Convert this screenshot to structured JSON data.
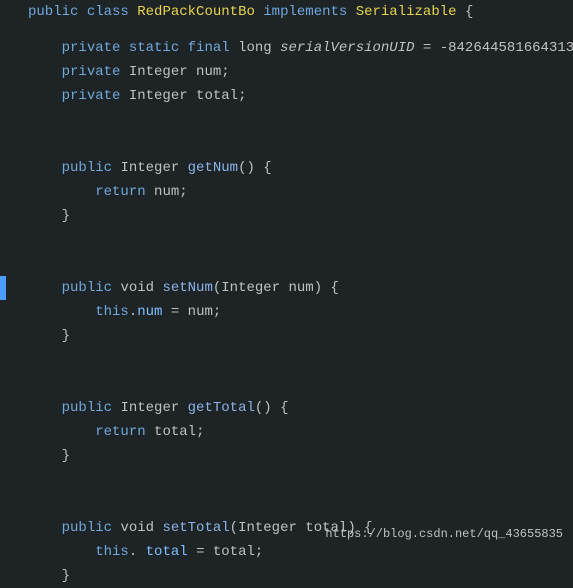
{
  "code": {
    "lines": [
      {
        "id": 1,
        "indicator": false,
        "content": "class_header"
      },
      {
        "id": 2,
        "indicator": false,
        "content": "blank"
      },
      {
        "id": 3,
        "indicator": false,
        "content": "serial"
      },
      {
        "id": 4,
        "indicator": false,
        "content": "num_field"
      },
      {
        "id": 5,
        "indicator": false,
        "content": "total_field"
      },
      {
        "id": 6,
        "indicator": false,
        "content": "blank"
      },
      {
        "id": 7,
        "indicator": false,
        "content": "blank"
      },
      {
        "id": 8,
        "indicator": false,
        "content": "getNum_header"
      },
      {
        "id": 9,
        "indicator": false,
        "content": "return_num"
      },
      {
        "id": 10,
        "indicator": false,
        "content": "close_brace"
      },
      {
        "id": 11,
        "indicator": false,
        "content": "blank"
      },
      {
        "id": 12,
        "indicator": false,
        "content": "blank"
      },
      {
        "id": 13,
        "indicator": true,
        "content": "setNum_header"
      },
      {
        "id": 14,
        "indicator": false,
        "content": "this_num"
      },
      {
        "id": 15,
        "indicator": false,
        "content": "close_brace"
      },
      {
        "id": 16,
        "indicator": false,
        "content": "blank"
      },
      {
        "id": 17,
        "indicator": false,
        "content": "blank"
      },
      {
        "id": 18,
        "indicator": false,
        "content": "getTotal_header"
      },
      {
        "id": 19,
        "indicator": false,
        "content": "return_total"
      },
      {
        "id": 20,
        "indicator": false,
        "content": "close_brace"
      },
      {
        "id": 21,
        "indicator": false,
        "content": "blank"
      },
      {
        "id": 22,
        "indicator": false,
        "content": "blank"
      },
      {
        "id": 23,
        "indicator": false,
        "content": "setTotal_header"
      },
      {
        "id": 24,
        "indicator": false,
        "content": "this_total"
      },
      {
        "id": 25,
        "indicator": false,
        "content": "close_brace"
      }
    ],
    "url": "https://blog.csdn.net/qq_43655835"
  }
}
